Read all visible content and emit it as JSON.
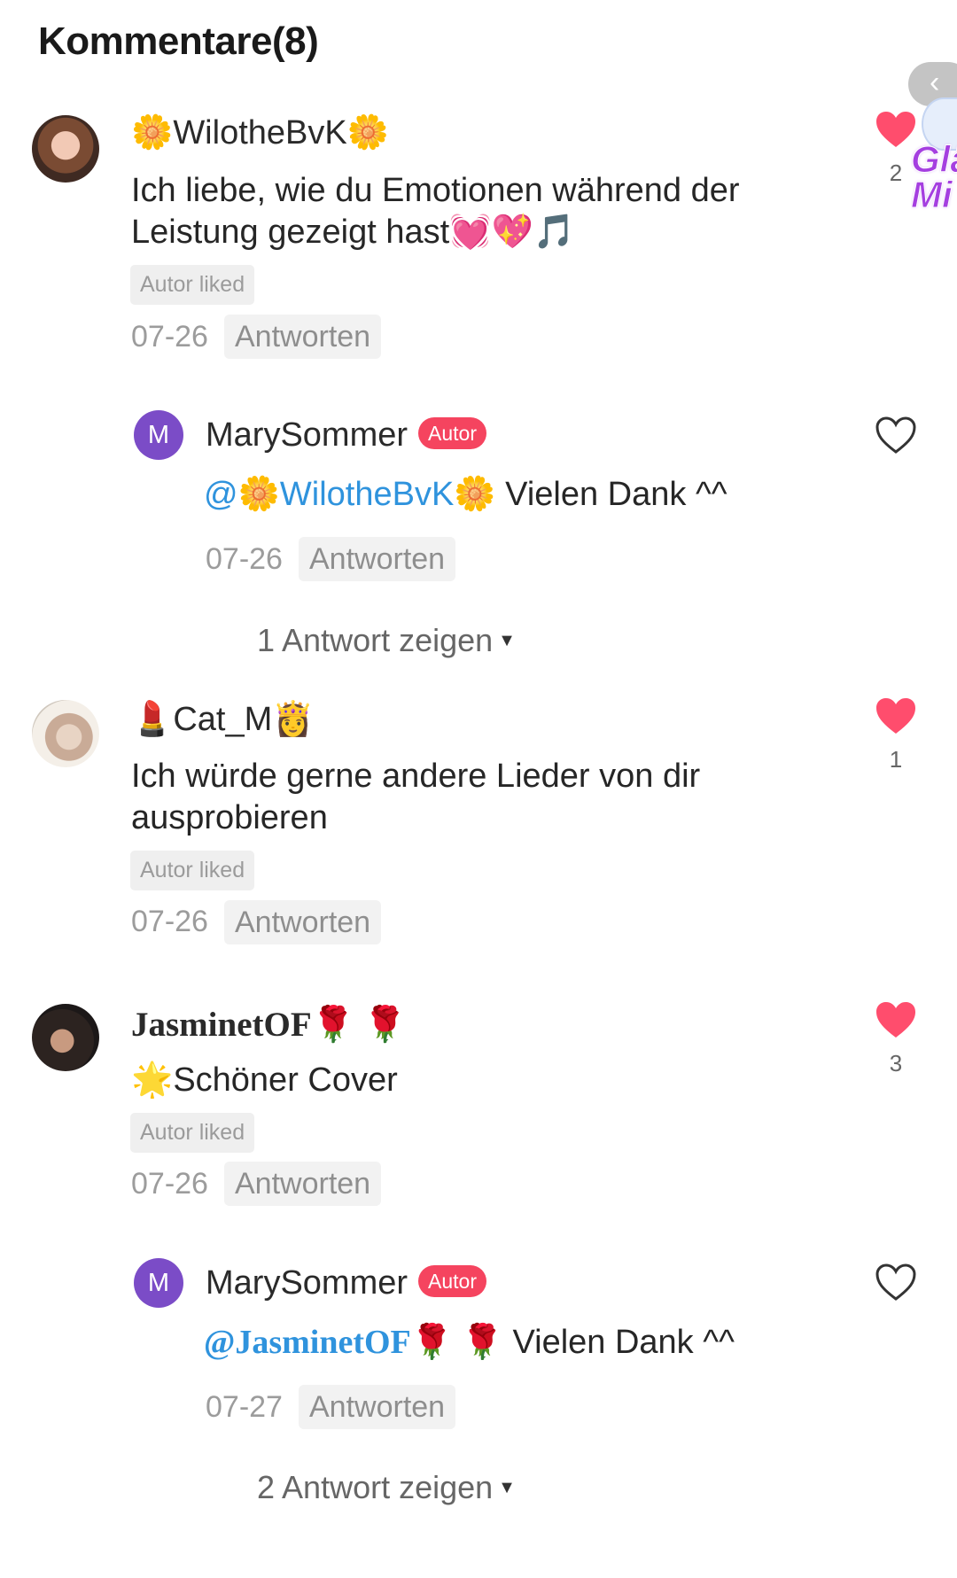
{
  "header": {
    "title": "Kommentare(8)"
  },
  "floating_badge": {
    "text": "Glä\nMi"
  },
  "icons": {
    "back": "chevron-left-icon",
    "like_filled": "heart-filled-icon",
    "like_outline": "heart-outline-icon",
    "caret": "caret-down-icon"
  },
  "colors": {
    "heart": "#ff4d6d",
    "autor_badge": "#f5445f",
    "mention": "#2f93dd",
    "avatar_letter_bg": "#7b4cc7"
  },
  "comments": [
    {
      "username": "🌼WilotheBvK🌼",
      "text": "Ich liebe, wie du Emotionen während der Leistung gezeigt hast💓💖🎵",
      "liked_tag": "Autor liked",
      "date": "07-26",
      "reply_label": "Antworten",
      "likes": "2",
      "reply": {
        "avatar_letter": "M",
        "username": "MarySommer",
        "badge": "Autor",
        "mention": "@🌼WilotheBvK🌼",
        "text": " Vielen Dank ^^",
        "date": "07-26",
        "reply_label": "Antworten"
      },
      "more_replies": "1 Antwort zeigen",
      "caret": "▼"
    },
    {
      "username": "💄Cat_M👸",
      "text": "Ich würde gerne andere Lieder von dir ausprobieren",
      "liked_tag": "Autor liked",
      "date": "07-26",
      "reply_label": "Antworten",
      "likes": "1"
    },
    {
      "username": "JasminetOF🌹 🌹",
      "text": "🌟Schöner Cover",
      "liked_tag": "Autor liked",
      "date": "07-26",
      "reply_label": "Antworten",
      "likes": "3",
      "reply": {
        "avatar_letter": "M",
        "username": "MarySommer",
        "badge": "Autor",
        "mention": "@JasminetOF🌹 🌹",
        "text": " Vielen Dank ^^",
        "date": "07-27",
        "reply_label": "Antworten"
      },
      "more_replies": "2 Antwort zeigen",
      "caret": "▼"
    }
  ]
}
